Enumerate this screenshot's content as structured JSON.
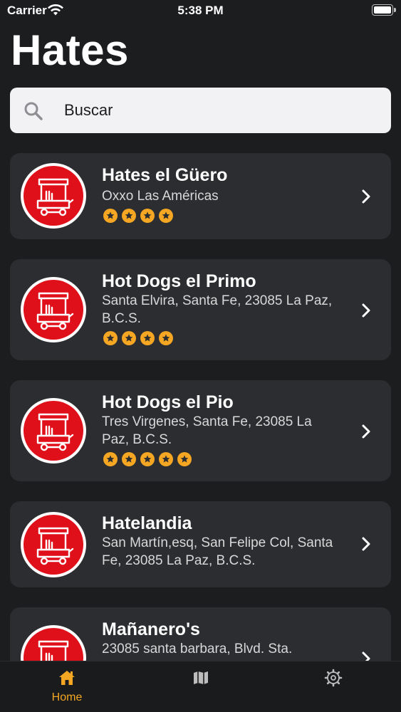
{
  "status_bar": {
    "carrier": "Carrier",
    "time": "5:38 PM"
  },
  "page_title": "Hates",
  "search": {
    "placeholder": "Buscar"
  },
  "places": [
    {
      "name": "Hates el Güero",
      "address": "Oxxo Las Américas",
      "rating": 4
    },
    {
      "name": "Hot Dogs el Primo",
      "address": "Santa Elvira, Santa Fe, 23085 La Paz, B.C.S.",
      "rating": 4
    },
    {
      "name": "Hot Dogs el Pio",
      "address": "Tres Virgenes, Santa Fe, 23085 La Paz, B.C.S.",
      "rating": 5
    },
    {
      "name": "Hatelandia",
      "address": "San Martín,esq, San Felipe Col, Santa Fe, 23085 La Paz, B.C.S.",
      "rating": 0
    },
    {
      "name": "Mañanero's",
      "address": "23085 santa barbara, Blvd. Sta.",
      "rating": 0
    }
  ],
  "tab_bar": {
    "tabs": [
      {
        "label": "Home",
        "icon": "home-icon",
        "active": true
      },
      {
        "label": "",
        "icon": "map-icon",
        "active": false
      },
      {
        "label": "",
        "icon": "gear-icon",
        "active": false
      }
    ]
  },
  "colors": {
    "accent": "#f5a623",
    "logo_red": "#e0101b",
    "card_bg": "#2b2d30",
    "background": "#1c1d1f"
  }
}
